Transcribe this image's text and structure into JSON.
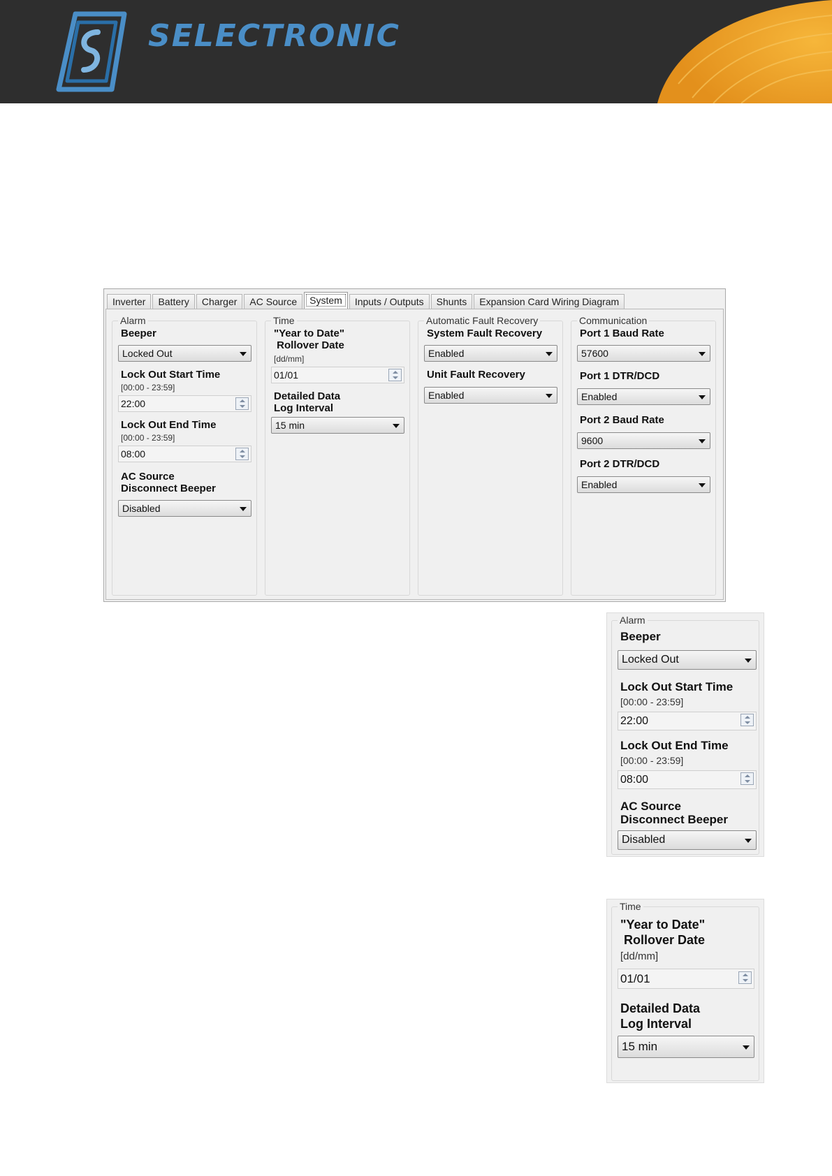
{
  "brand": {
    "name": "SELECTRONIC"
  },
  "colors": {
    "header_bg": "#2e2e2e",
    "brand_blue": "#4a8ec7",
    "accent_orange": "#f0a21f"
  },
  "tabs": [
    "Inverter",
    "Battery",
    "Charger",
    "AC Source",
    "System",
    "Inputs / Outputs",
    "Shunts",
    "Expansion Card Wiring Diagram"
  ],
  "active_tab": "System",
  "alarm": {
    "title": "Alarm",
    "beeper_label": "Beeper",
    "beeper_value": "Locked Out",
    "start_label": "Lock Out Start Time",
    "start_range": "[00:00 - 23:59]",
    "start_value": "22:00",
    "end_label": "Lock Out End Time",
    "end_range": "[00:00 - 23:59]",
    "end_value": "08:00",
    "ac_label": "AC Source\nDisconnect Beeper",
    "ac_value": "Disabled"
  },
  "time": {
    "title": "Time",
    "rollover_label": "\"Year to Date\"\n Rollover Date",
    "rollover_format": "[dd/mm]",
    "rollover_value": "01/01",
    "log_label": "Detailed Data\nLog Interval",
    "log_value": "15 min"
  },
  "fault": {
    "title": "Automatic Fault Recovery",
    "system_label": "System Fault Recovery",
    "system_value": "Enabled",
    "unit_label": "Unit Fault Recovery",
    "unit_value": "Enabled"
  },
  "comm": {
    "title": "Communication",
    "p1_baud_label": "Port 1 Baud Rate",
    "p1_baud_value": "57600",
    "p1_dtr_label": "Port 1 DTR/DCD",
    "p1_dtr_value": "Enabled",
    "p2_baud_label": "Port 2 Baud Rate",
    "p2_baud_value": "9600",
    "p2_dtr_label": "Port 2 DTR/DCD",
    "p2_dtr_value": "Enabled"
  }
}
